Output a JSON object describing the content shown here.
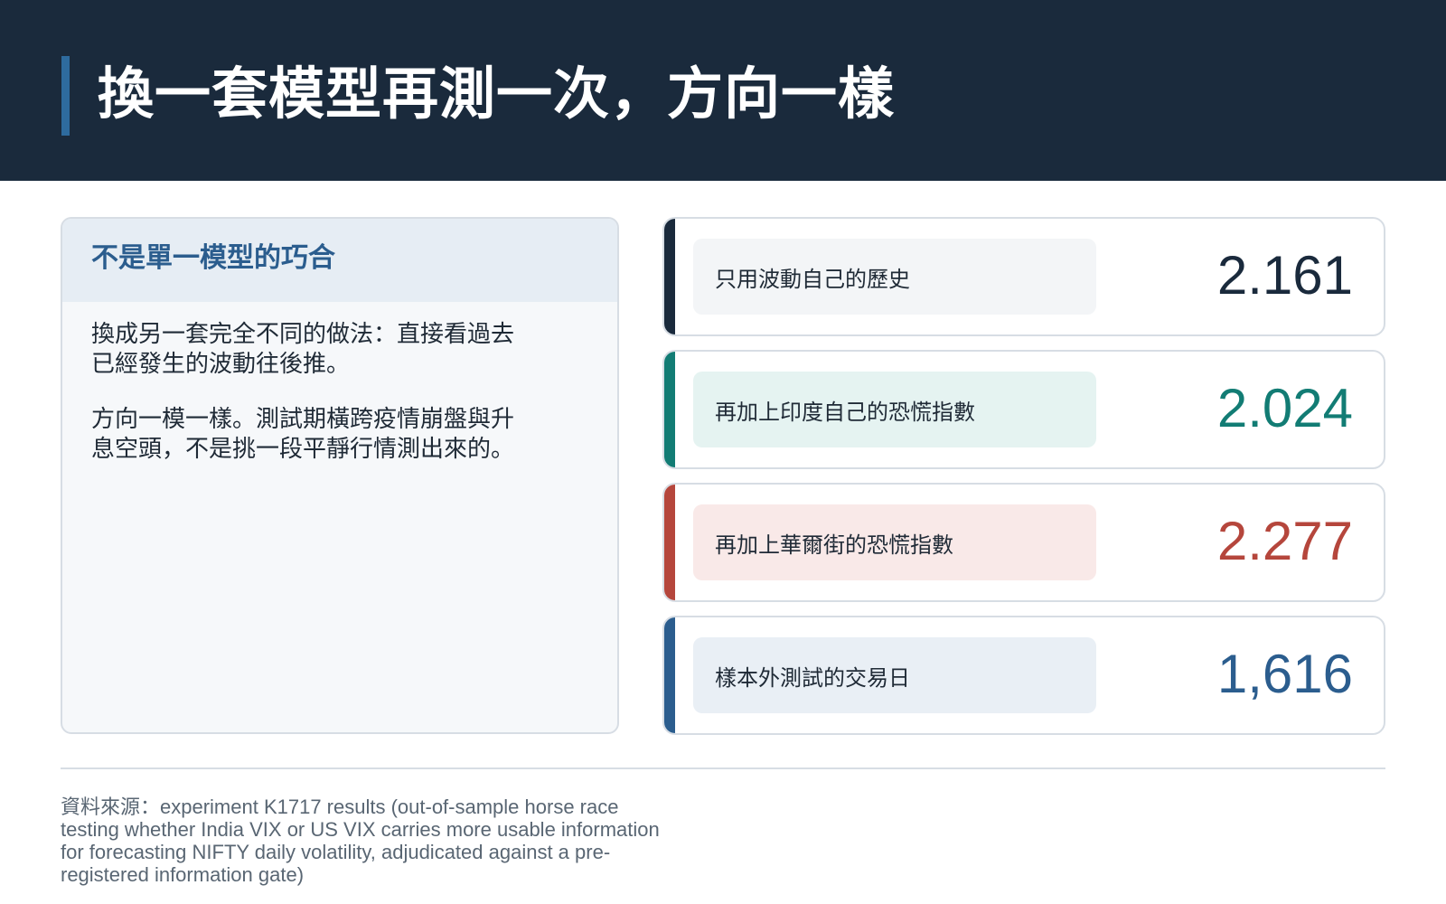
{
  "header": {
    "title": "換一套模型再測一次，方向一樣"
  },
  "panel": {
    "heading": "不是單一模型的巧合",
    "paragraphs": [
      "換成另一套完全不同的做法：直接看過去已經發生的波動往後推。",
      "方向一模一樣。測試期橫跨疫情崩盤與升息空頭，不是挑一段平靜行情測出來的。"
    ]
  },
  "metrics": [
    {
      "label": "只用波動自己的歷史",
      "value": "2.161",
      "accent_color": "#1a2a3c",
      "value_color": "#1a2a3c",
      "label_bg": "#f3f5f7"
    },
    {
      "label": "再加上印度自己的恐慌指數",
      "value": "2.024",
      "accent_color": "#127c74",
      "value_color": "#127c74",
      "label_bg": "#e5f3f1"
    },
    {
      "label": "再加上華爾街的恐慌指數",
      "value": "2.277",
      "accent_color": "#b5463c",
      "value_color": "#b5463c",
      "label_bg": "#f9e9e8"
    },
    {
      "label": "樣本外測試的交易日",
      "value": "1,616",
      "accent_color": "#2b5d8e",
      "value_color": "#2b5d8e",
      "label_bg": "#e9eff5"
    }
  ],
  "footer": {
    "source": "資料來源：experiment K1717 results (out-of-sample horse race testing whether India VIX or US VIX carries more usable information for forecasting NIFTY daily volatility, adjudicated against a pre-registered information gate)"
  }
}
